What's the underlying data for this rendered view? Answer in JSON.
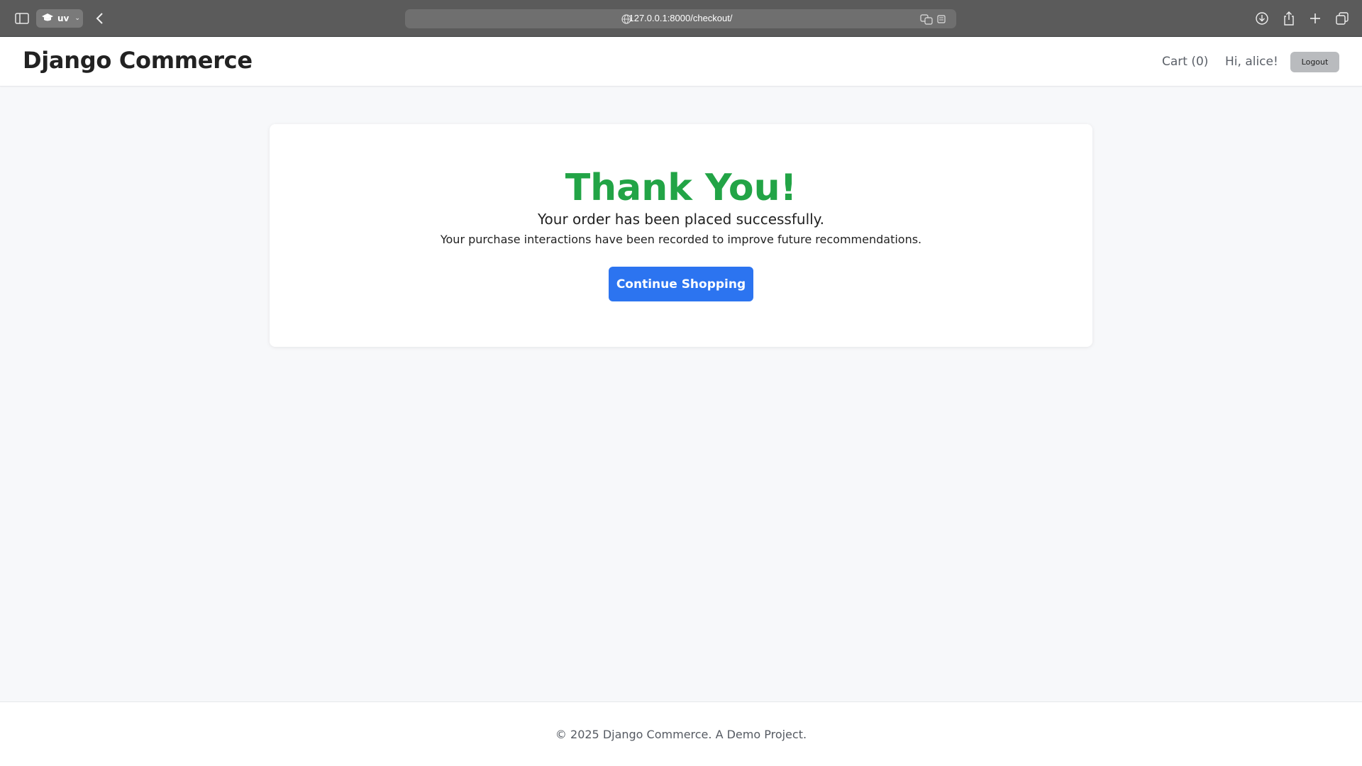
{
  "browser": {
    "url": "127.0.0.1:8000/checkout/",
    "profile_label": "uv",
    "icons": [
      "sidebar-icon",
      "graduation-cap-icon",
      "chevron-down-icon",
      "back-icon",
      "globe-icon",
      "translate-icon",
      "reader-icon",
      "download-icon",
      "share-icon",
      "new-tab-icon",
      "tabs-overview-icon"
    ]
  },
  "header": {
    "brand": "Django Commerce",
    "cart_label": "Cart (0)",
    "greeting": "Hi, alice!",
    "logout_label": "Logout"
  },
  "confirmation": {
    "title": "Thank You!",
    "subtitle": "Your order has been placed successfully.",
    "note": "Your purchase interactions have been recorded to improve future recommendations.",
    "button_label": "Continue Shopping"
  },
  "footer": {
    "text": "© 2025 Django Commerce. A Demo Project."
  },
  "colors": {
    "success_green": "#22a446",
    "primary_blue": "#2c74f0",
    "page_bg": "#f7f8fa"
  }
}
